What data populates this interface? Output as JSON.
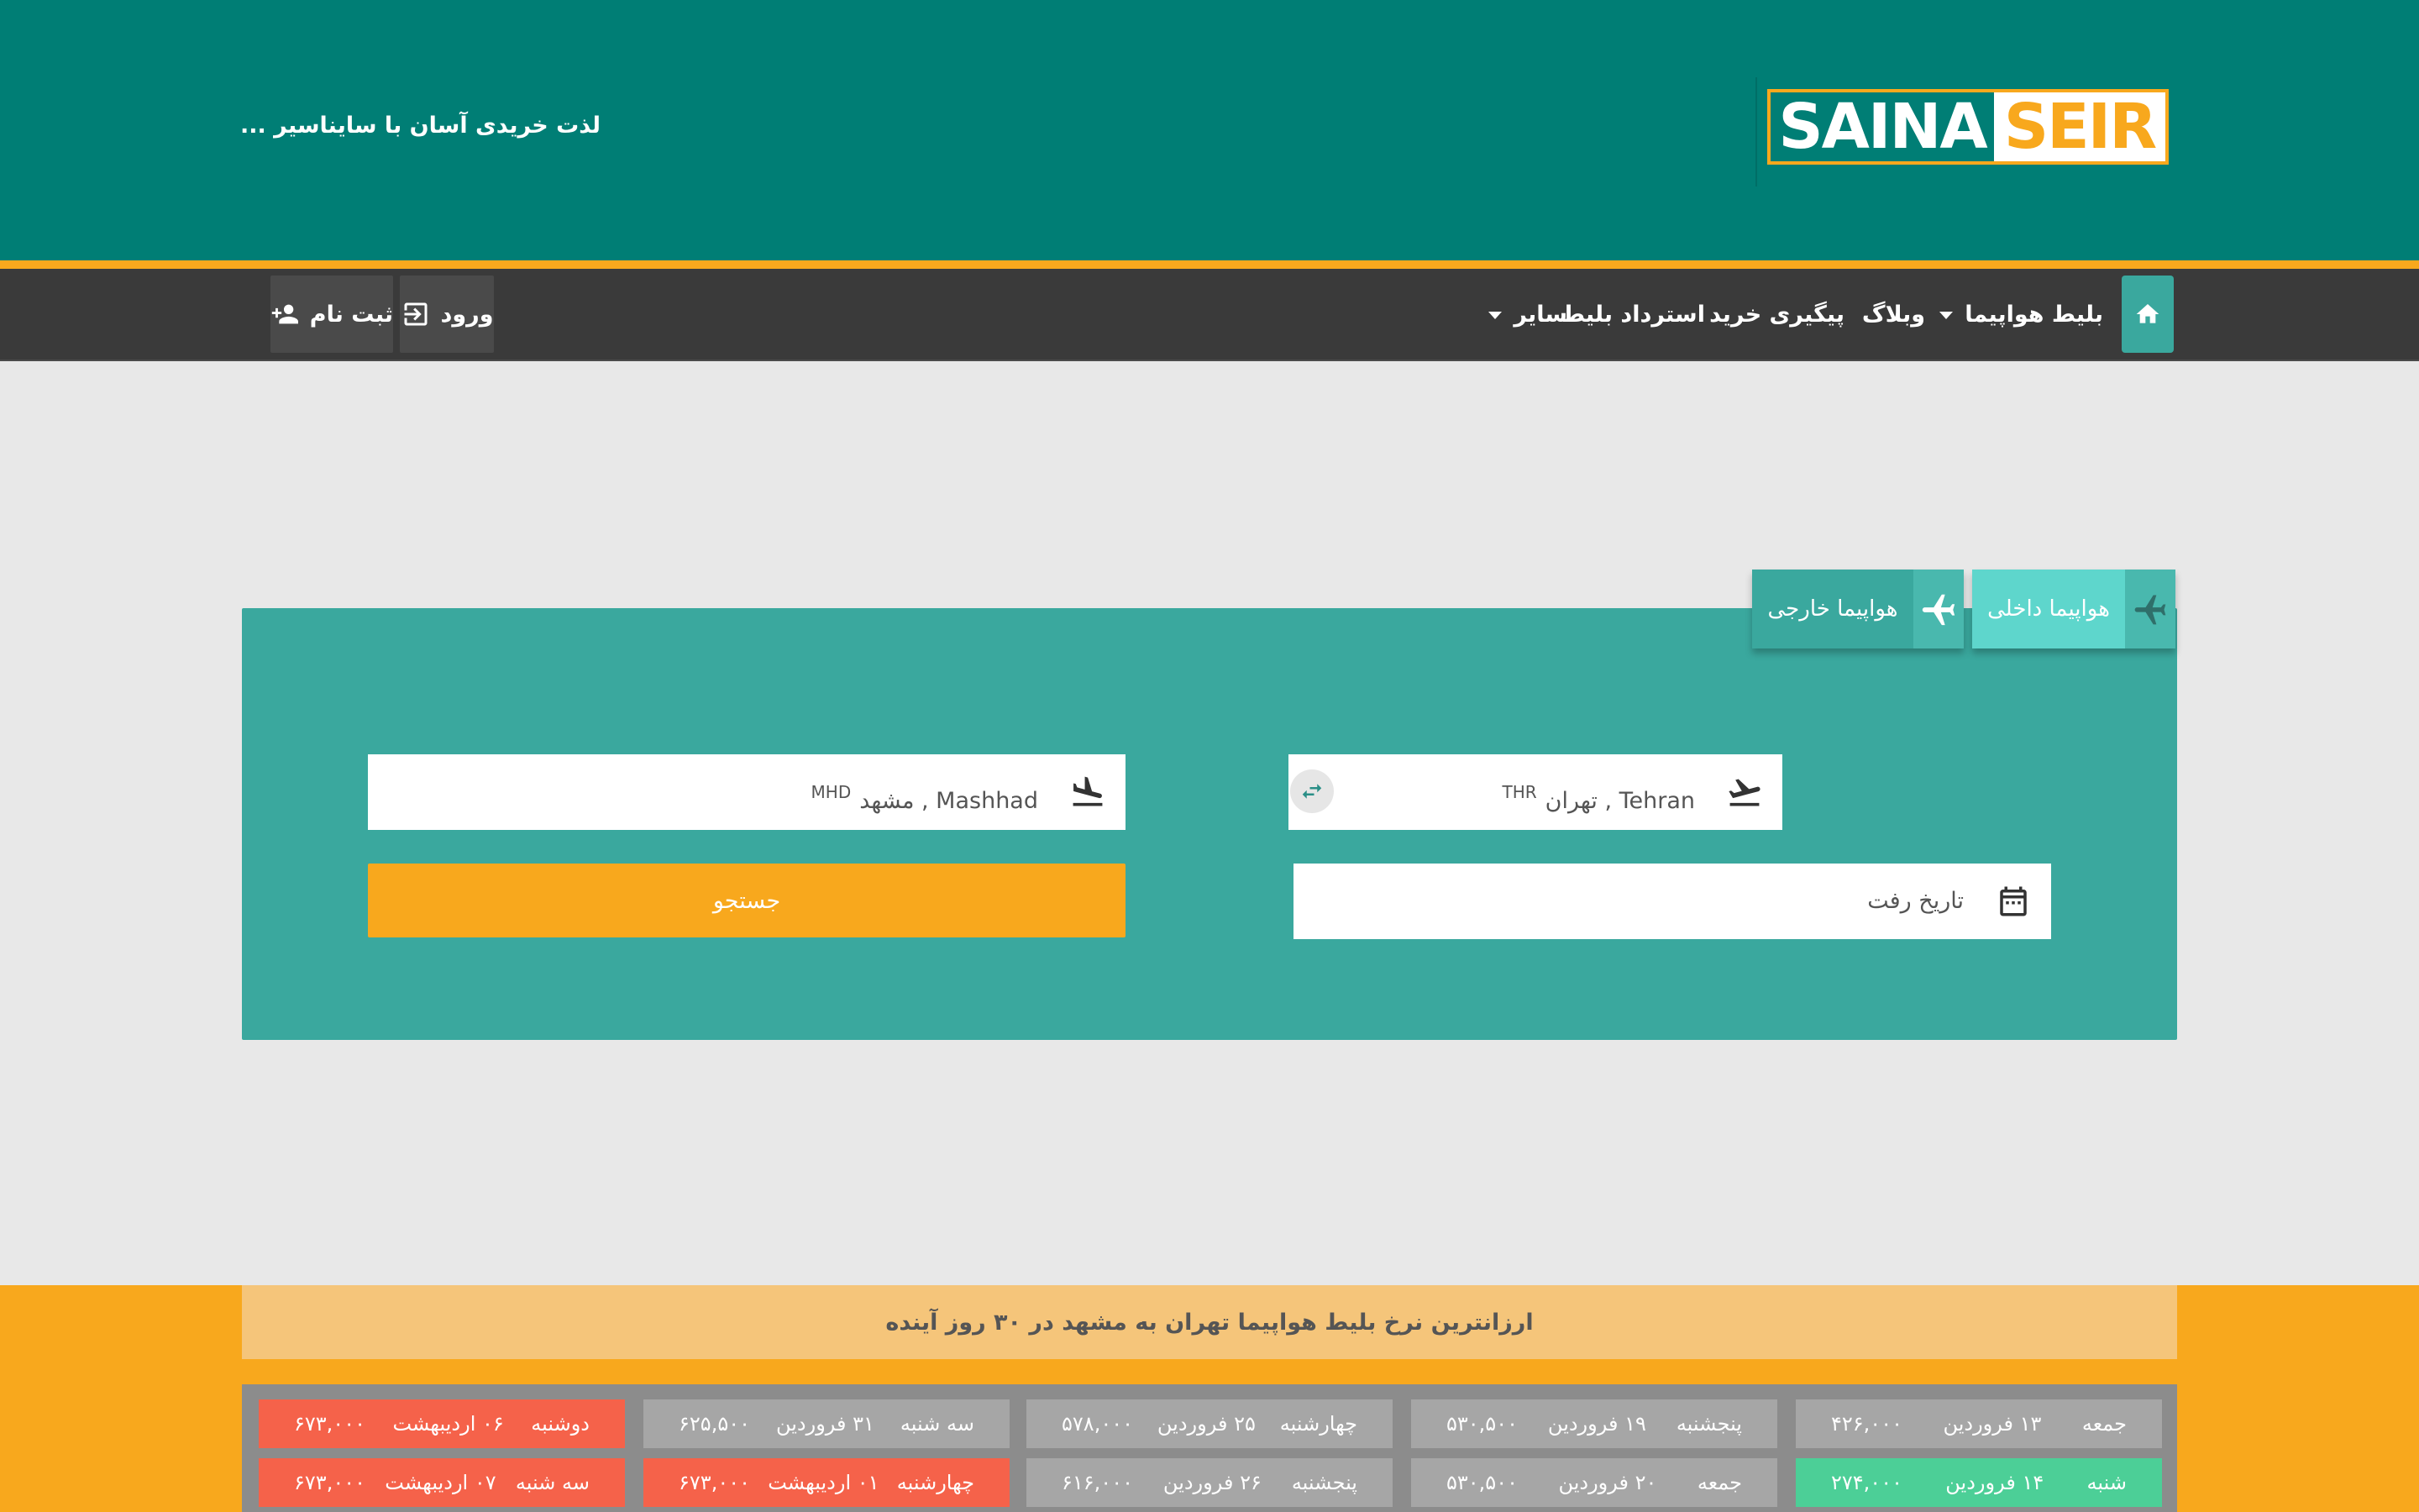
{
  "header": {
    "logo_left": "SAINA",
    "logo_right": "SEIR",
    "tagline": "لذت خریدی آسان با سایناسیر ..."
  },
  "nav": {
    "items": [
      {
        "label": "بلیط هواپیما",
        "dropdown": true
      },
      {
        "label": "وبلاگ"
      },
      {
        "label": "پیگیری خرید"
      },
      {
        "label": "استرداد بلیط"
      },
      {
        "label": "سایر",
        "dropdown": true
      }
    ],
    "login": "ورود",
    "register": "ثبت نام"
  },
  "search": {
    "tabs": [
      {
        "label": "هواپیما داخلی",
        "active": false
      },
      {
        "label": "هواپیما خارجی",
        "active": true
      }
    ],
    "origin": {
      "value": "Tehran , تهران",
      "code": "THR"
    },
    "destination": {
      "value": "Mashhad , مشهد",
      "code": "MHD"
    },
    "date_placeholder": "تاریخ رفت",
    "search_button": "جستجو"
  },
  "cheapest": {
    "title": "ارزانترین نرخ بلیط هواپیما تهران به مشهد در ۳۰ روز آینده",
    "rows": [
      [
        {
          "day": "جمعه",
          "date": "۱۳ فروردین",
          "price": "۴۲۶,۰۰۰",
          "status": "gray"
        },
        {
          "day": "پنجشنبه",
          "date": "۱۹ فروردین",
          "price": "۵۳۰,۵۰۰",
          "status": "gray"
        },
        {
          "day": "چهارشنبه",
          "date": "۲۵ فروردین",
          "price": "۵۷۸,۰۰۰",
          "status": "gray"
        },
        {
          "day": "سه شنبه",
          "date": "۳۱ فروردین",
          "price": "۶۲۵,۵۰۰",
          "status": "gray"
        },
        {
          "day": "دوشنبه",
          "date": "۰۶ اردیبهشت",
          "price": "۶۷۳,۰۰۰",
          "status": "red"
        }
      ],
      [
        {
          "day": "شنبه",
          "date": "۱۴ فروردین",
          "price": "۲۷۴,۰۰۰",
          "status": "green"
        },
        {
          "day": "جمعه",
          "date": "۲۰ فروردین",
          "price": "۵۳۰,۵۰۰",
          "status": "gray"
        },
        {
          "day": "پنجشنبه",
          "date": "۲۶ فروردین",
          "price": "۶۱۶,۰۰۰",
          "status": "gray"
        },
        {
          "day": "چهارشنبه",
          "date": "۰۱ اردیبهشت",
          "price": "۶۷۳,۰۰۰",
          "status": "red"
        },
        {
          "day": "سه شنبه",
          "date": "۰۷ اردیبهشت",
          "price": "۶۷۳,۰۰۰",
          "status": "red"
        }
      ]
    ]
  }
}
